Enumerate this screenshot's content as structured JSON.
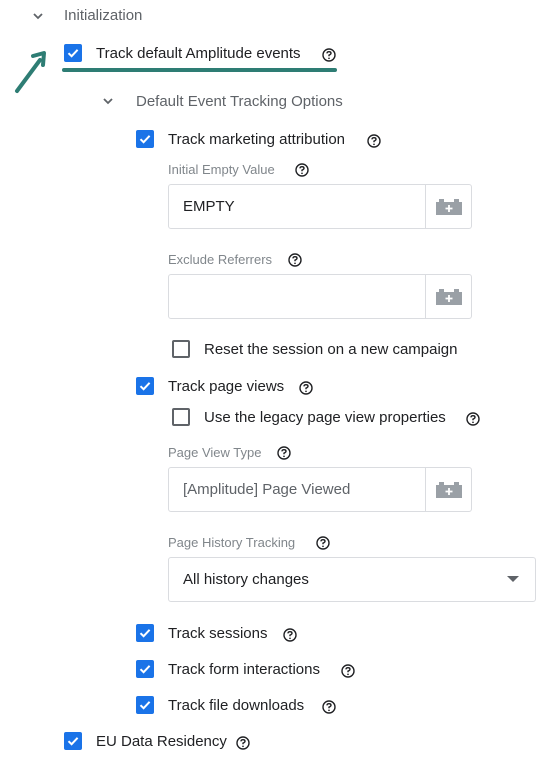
{
  "initialization": {
    "title": "Initialization",
    "track_default_label": "Track default Amplitude events"
  },
  "default_options": {
    "title": "Default Event Tracking Options",
    "track_marketing_label": "Track marketing attribution",
    "initial_empty_value_label": "Initial Empty Value",
    "initial_empty_value": "EMPTY",
    "exclude_referrers_label": "Exclude Referrers",
    "exclude_referrers_value": "",
    "reset_session_label": "Reset the session on a new campaign",
    "track_page_views_label": "Track page views",
    "legacy_props_label": "Use the legacy page view properties",
    "page_view_type_label": "Page View Type",
    "page_view_type_placeholder": "[Amplitude] Page Viewed",
    "page_history_label": "Page History Tracking",
    "page_history_value": "All history changes",
    "track_sessions_label": "Track sessions",
    "track_forms_label": "Track form interactions",
    "track_downloads_label": "Track file downloads"
  },
  "eu_residency_label": "EU Data Residency",
  "checkbox_states": {
    "track_default": true,
    "track_marketing": true,
    "reset_session": false,
    "track_page_views": true,
    "legacy_props": false,
    "track_sessions": true,
    "track_forms": true,
    "track_downloads": true,
    "eu_residency": true
  },
  "colors": {
    "checkbox_checked": "#1a73e8",
    "annotation": "#2e7d74",
    "field_border": "#dadce0",
    "muted_text": "#80868b"
  },
  "icons": {
    "collapse": "chevron-down-icon",
    "help": "help-circle-icon",
    "variable": "variable-brick-icon",
    "dropdown": "caret-down-icon",
    "annotation": "arrow-annotation"
  }
}
